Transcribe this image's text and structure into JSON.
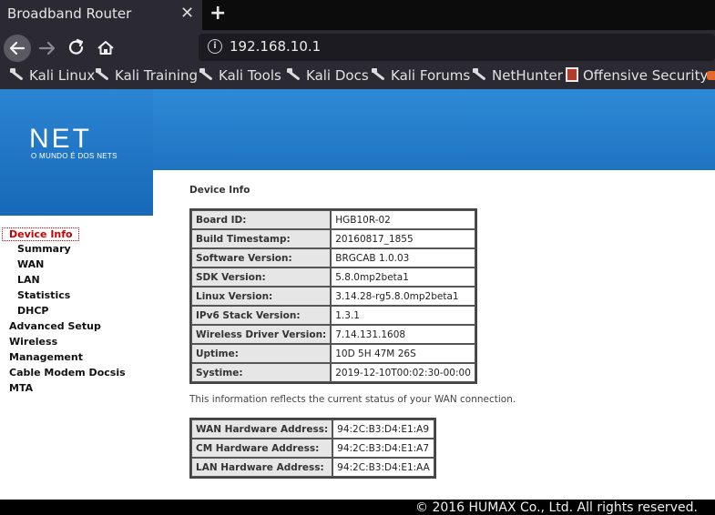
{
  "browser": {
    "tab_title": "Broadband Router",
    "tab_close": "✕",
    "new_tab": "+",
    "url": "192.168.10.1",
    "bookmarks": [
      "Kali Linux",
      "Kali Training",
      "Kali Tools",
      "Kali Docs",
      "Kali Forums",
      "NetHunter",
      "Offensive Security"
    ]
  },
  "brand": {
    "logo": "NET",
    "tagline": "O MUNDO É DOS NETS",
    "banner_color": "#1f74c2"
  },
  "sidebar": {
    "active": "Device Info",
    "sub_items": [
      "Summary",
      "WAN",
      "LAN",
      "Statistics",
      "DHCP"
    ],
    "items": [
      "Advanced Setup",
      "Wireless",
      "Management",
      "Cable Modem Docsis",
      "MTA"
    ]
  },
  "main": {
    "title": "Device Info",
    "device_rows": [
      {
        "label": "Board ID:",
        "value": "HGB10R-02"
      },
      {
        "label": "Build Timestamp:",
        "value": "20160817_1855"
      },
      {
        "label": "Software Version:",
        "value": "BRGCAB 1.0.03"
      },
      {
        "label": "SDK Version:",
        "value": "5.8.0mp2beta1"
      },
      {
        "label": "Linux Version:",
        "value": "3.14.28-rg5.8.0mp2beta1"
      },
      {
        "label": "IPv6 Stack Version:",
        "value": "1.3.1"
      },
      {
        "label": "Wireless Driver Version:",
        "value": "7.14.131.1608"
      },
      {
        "label": "Uptime:",
        "value": "10D 5H 47M 26S"
      },
      {
        "label": "Systime:",
        "value": "2019-12-10T00:02:30-00:00"
      }
    ],
    "note": "This information reflects the current status of your WAN connection.",
    "mac_rows": [
      {
        "label": "WAN Hardware Address:",
        "value": "94:2C:B3:D4:E1:A9"
      },
      {
        "label": "CM Hardware Address:",
        "value": "94:2C:B3:D4:E1:A7"
      },
      {
        "label": "LAN Hardware Address:",
        "value": "94:2C:B3:D4:E1:AA"
      }
    ]
  },
  "footer": {
    "text": "© 2016 HUMAX Co., Ltd. All rights reserved."
  }
}
